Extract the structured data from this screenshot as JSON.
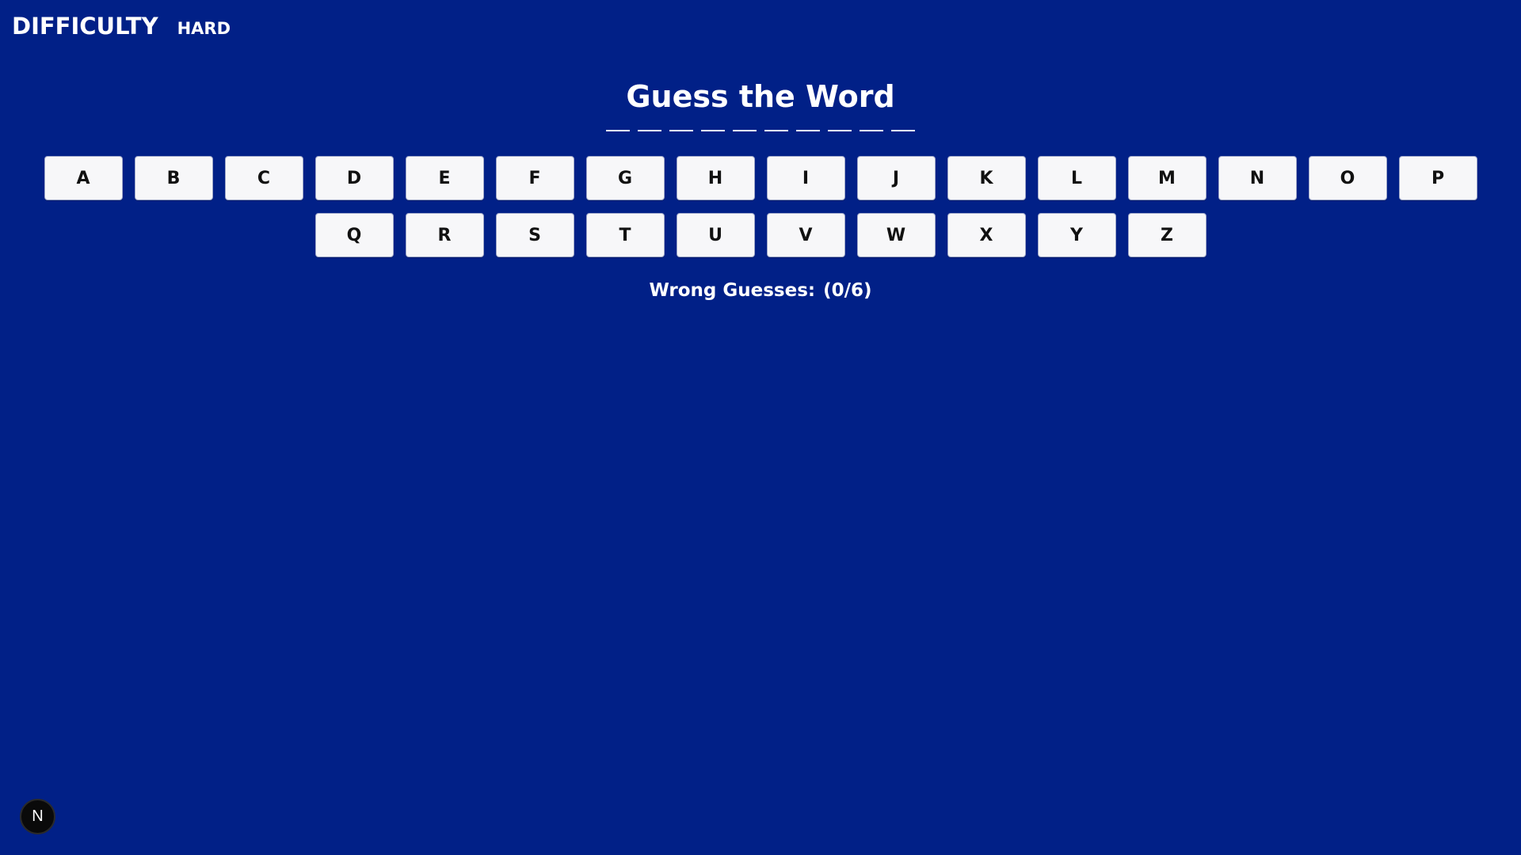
{
  "header": {
    "difficulty_label": "DIFFICULTY",
    "difficulty_value": "HARD"
  },
  "game": {
    "title": "Guess the Word",
    "word_length": 10,
    "wrong_label": "Wrong Guesses:",
    "wrong_count": "(0/6)"
  },
  "keyboard": {
    "row1": [
      "A",
      "B",
      "C",
      "D",
      "E",
      "F",
      "G",
      "H",
      "I",
      "J",
      "K",
      "L",
      "M",
      "N",
      "O",
      "P"
    ],
    "row2": [
      "Q",
      "R",
      "S",
      "T",
      "U",
      "V",
      "W",
      "X",
      "Y",
      "Z"
    ]
  },
  "badge": {
    "letter": "N",
    "icon": "nextjs-icon"
  },
  "colors": {
    "background": "#012087",
    "key_background": "#f7f7f9",
    "text": "#ffffff"
  }
}
